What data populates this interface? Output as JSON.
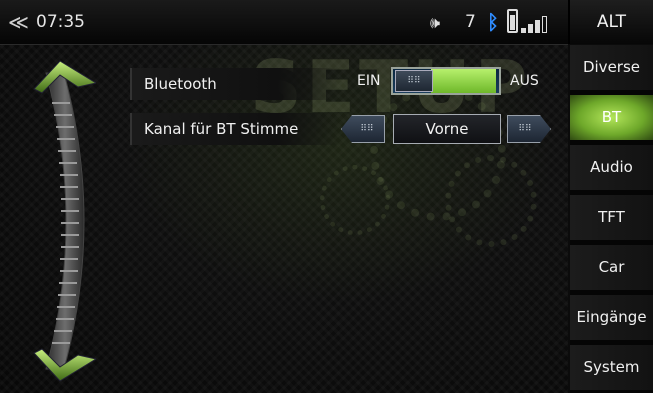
{
  "statusbar": {
    "back_icon": "≪",
    "time": "07:35",
    "volume_icon": "speaker-icon",
    "volume_glyph": "🕪",
    "volume_level": "7",
    "bluetooth_glyph": "ᛒ",
    "bluetooth_color": "#2f8cff",
    "alt_label": "ALT"
  },
  "watermark": "SETUP",
  "settings": {
    "bluetooth": {
      "label": "Bluetooth",
      "on_label": "EIN",
      "off_label": "AUS",
      "state_fraction": 0.95,
      "knob_glyph": "⠿⠿",
      "accent": "#8fd040"
    },
    "channel": {
      "label": "Kanal für BT Stimme",
      "value": "Vorne",
      "left_glyph": "⠿⠿",
      "right_glyph": "⠿⠿"
    }
  },
  "sidebar": {
    "items": [
      {
        "label": "Diverse",
        "active": false
      },
      {
        "label": "BT",
        "active": true
      },
      {
        "label": "Audio",
        "active": false
      },
      {
        "label": "TFT",
        "active": false
      },
      {
        "label": "Car",
        "active": false
      },
      {
        "label": "Eingänge",
        "active": false
      },
      {
        "label": "System",
        "active": false
      }
    ],
    "active_color": "#8fd040"
  }
}
